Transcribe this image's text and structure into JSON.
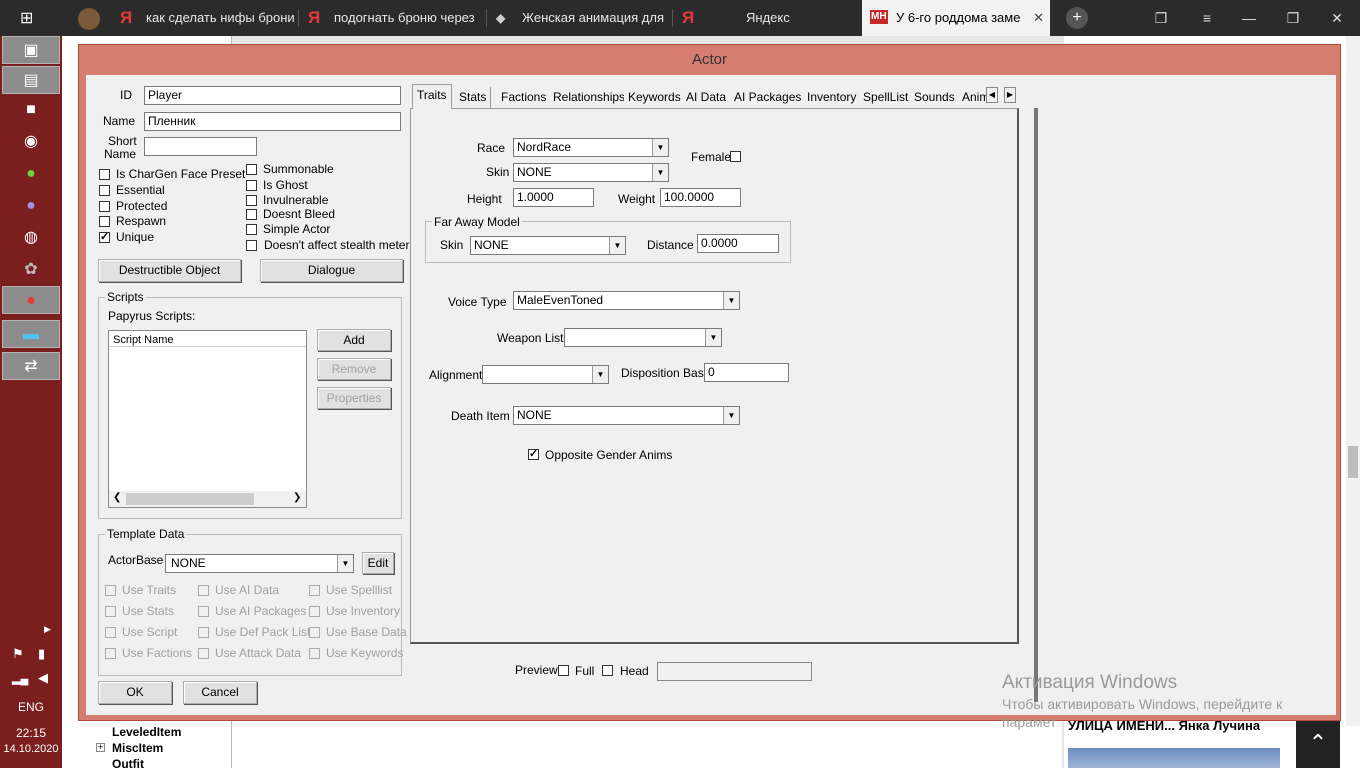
{
  "browser": {
    "tabs": [
      {
        "title": ""
      },
      {
        "title": "как сделать нифы брони"
      },
      {
        "title": "подогнать броню через"
      },
      {
        "title": "Женская анимация для"
      },
      {
        "title": "Яндекс"
      },
      {
        "title": "У 6-го роддома заме"
      }
    ],
    "yandex_glyph": "Я",
    "new_tab": "+",
    "active_tab_badge": "МН"
  },
  "taskbar": {
    "lang": "ENG",
    "time": "22:15",
    "date": "14.10.2020"
  },
  "background": {
    "tree": [
      "LeveledItem",
      "MiscItem",
      "Outfit"
    ],
    "news_title": "УЛИЦА ИМЕНИ... Янка Лучина",
    "activation_title": "Активация Windows",
    "activation_text": "Чтобы активировать Windows, перейдите к",
    "activation_text2": "парамет"
  },
  "dialog": {
    "title": "Actor",
    "id_label": "ID",
    "id_value": "Player",
    "name_label": "Name",
    "name_value": "Пленник",
    "short_name_label1": "Short",
    "short_name_label2": "Name",
    "short_name_value": "",
    "flags_left": [
      {
        "label": "Is CharGen Face Preset",
        "checked": false
      },
      {
        "label": "Essential",
        "checked": false
      },
      {
        "label": "Protected",
        "checked": false
      },
      {
        "label": "Respawn",
        "checked": false
      },
      {
        "label": "Unique",
        "checked": true
      }
    ],
    "flags_right": [
      {
        "label": "Summonable",
        "checked": false
      },
      {
        "label": "Is Ghost",
        "checked": false
      },
      {
        "label": "Invulnerable",
        "checked": false
      },
      {
        "label": "Doesnt Bleed",
        "checked": false
      },
      {
        "label": "Simple Actor",
        "checked": false
      },
      {
        "label": "Doesn't affect stealth meter",
        "checked": false
      }
    ],
    "destructible_btn": "Destructible Object",
    "dialogue_btn": "Dialogue",
    "scripts": {
      "group": "Scripts",
      "papyrus": "Papyrus Scripts:",
      "column": "Script Name",
      "add": "Add",
      "remove": "Remove",
      "properties": "Properties"
    },
    "template": {
      "group": "Template Data",
      "actorbase_label": "ActorBase",
      "actorbase_value": "NONE",
      "edit": "Edit",
      "flags": [
        "Use Traits",
        "Use AI Data",
        "Use Spelllist",
        "Use Stats",
        "Use AI Packages",
        "Use Inventory",
        "Use Script",
        "Use Def Pack List",
        "Use Base Data",
        "Use Factions",
        "Use Attack Data",
        "Use Keywords"
      ]
    },
    "ok": "OK",
    "cancel": "Cancel",
    "tabs": [
      "Traits",
      "Stats",
      "Factions",
      "Relationships",
      "Keywords",
      "AI Data",
      "AI Packages",
      "Inventory",
      "SpellList",
      "Sounds",
      "Anim"
    ],
    "traits": {
      "race_label": "Race",
      "race_value": "NordRace",
      "female_label": "Female",
      "female_checked": false,
      "skin_label": "Skin",
      "skin_value": "NONE",
      "height_label": "Height",
      "height_value": "1.0000",
      "weight_label": "Weight",
      "weight_value": "100.0000",
      "far_away_group": "Far Away Model",
      "far_skin_label": "Skin",
      "far_skin_value": "NONE",
      "distance_label": "Distance",
      "distance_value": "0.0000",
      "voice_label": "Voice Type",
      "voice_value": "MaleEvenToned",
      "weapon_label": "Weapon List",
      "weapon_value": "",
      "alignment_label": "Alignment",
      "alignment_value": "",
      "disposition_label": "Disposition Base",
      "disposition_value": "0",
      "death_label": "Death Item",
      "death_value": "NONE",
      "opposite_label": "Opposite Gender Anims",
      "opposite_checked": true
    },
    "preview": {
      "preview_label": "Preview",
      "full_label": "Full",
      "head_label": "Head"
    }
  },
  "colors": {
    "dialog_frame": "#d57e70",
    "taskbar": "#7b1e1e",
    "client": "#f0f0f0"
  }
}
